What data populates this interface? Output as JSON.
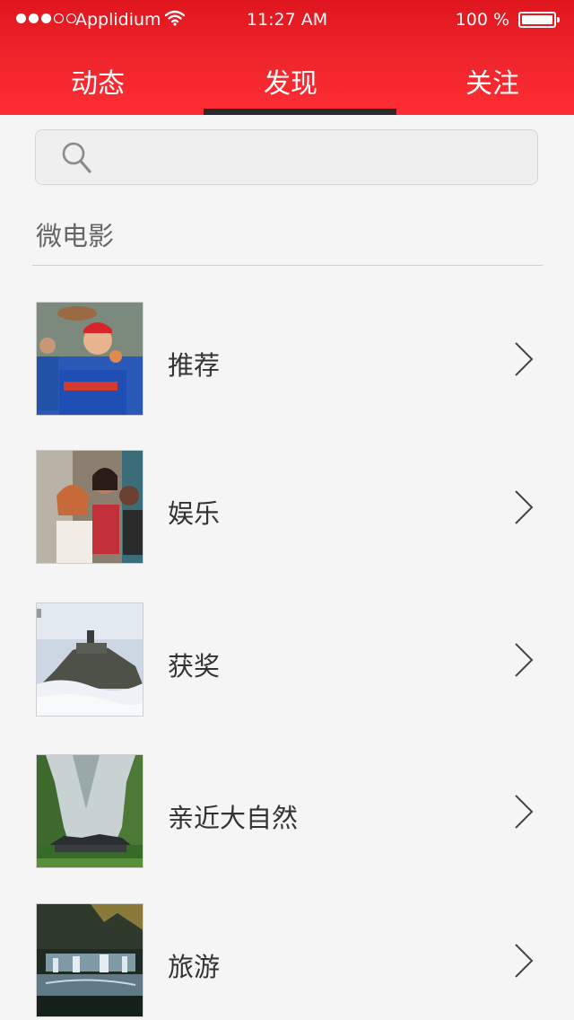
{
  "status_bar": {
    "carrier": "Applidium",
    "time": "11:27 AM",
    "battery": "100 %"
  },
  "tabs": [
    {
      "label": "动态"
    },
    {
      "label": "发现"
    },
    {
      "label": "关注"
    }
  ],
  "search": {
    "icon": "search-icon"
  },
  "section": {
    "title": "微电影"
  },
  "items": [
    {
      "label": "推荐",
      "thumb": "kids-baseball-photo"
    },
    {
      "label": "娱乐",
      "thumb": "girls-group-photo"
    },
    {
      "label": "获奖",
      "thumb": "hilltop-town-in-clouds-photo"
    },
    {
      "label": "亲近大自然",
      "thumb": "green-valley-village-photo"
    },
    {
      "label": "旅游",
      "thumb": "waterfall-photo"
    }
  ],
  "colors": {
    "header_red": "#f0262d",
    "tab_indicator": "#2a2a2a",
    "background": "#f5f5f5"
  }
}
